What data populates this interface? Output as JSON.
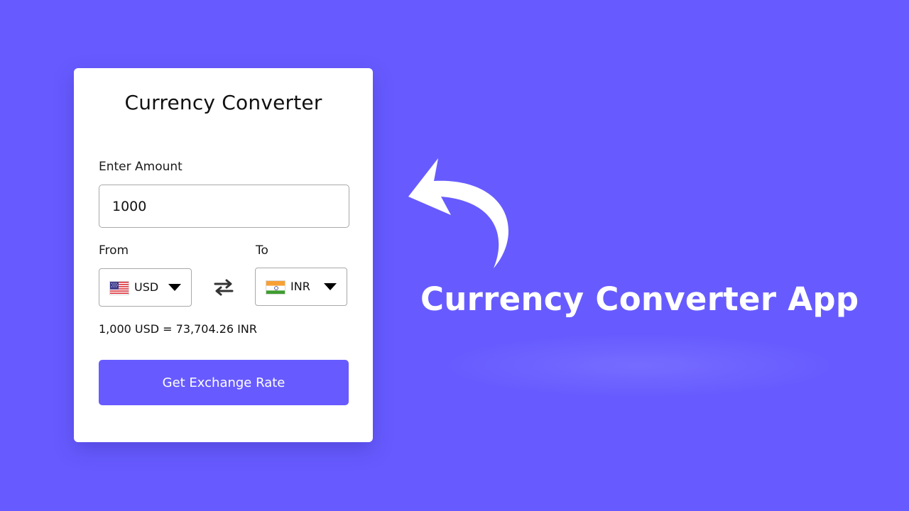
{
  "card": {
    "title": "Currency Converter",
    "amount_label": "Enter Amount",
    "amount_value": "1000",
    "from_label": "From",
    "to_label": "To",
    "from_currency": {
      "code": "USD",
      "flag_icon": "us-flag-icon"
    },
    "to_currency": {
      "code": "INR",
      "flag_icon": "india-flag-icon"
    },
    "swap_icon": "swap-arrows-icon",
    "result_text": "1,000 USD = 73,704.26 INR",
    "button_label": "Get Exchange Rate"
  },
  "hero": {
    "title": "Currency Converter App",
    "arrow_icon": "curved-arrow-icon"
  },
  "colors": {
    "background": "#675bff",
    "accent": "#675bff",
    "card": "#ffffff"
  }
}
